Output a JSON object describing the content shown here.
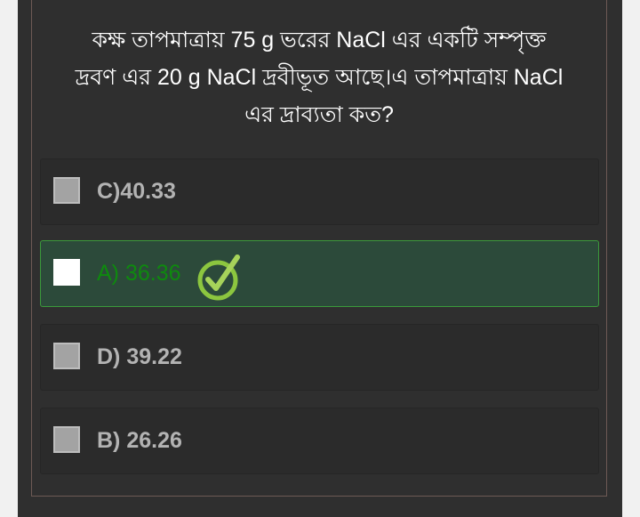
{
  "question": {
    "line1": "কক্ষ তাপমাত্রায় 75 g ভরের NaCl এর একটি সম্পৃক্ত",
    "line2": "দ্রবণ এর 20 g NaCl দ্রবীভূত আছে।এ তাপমাত্রায় NaCl",
    "line3": "এর দ্রাব্যতা কত?"
  },
  "options": [
    {
      "label": "C)40.33",
      "state": "unselected"
    },
    {
      "label": "A) 36.36",
      "state": "correct"
    },
    {
      "label": "D) 39.22",
      "state": "unselected"
    },
    {
      "label": "B) 26.26",
      "state": "unselected"
    }
  ],
  "icons": {
    "correct_marker": "check-circle-icon"
  },
  "colors": {
    "correct_text": "#0e8a0e",
    "correct_bg": "#2c4a3a",
    "check_icon": "#8cc63f"
  }
}
